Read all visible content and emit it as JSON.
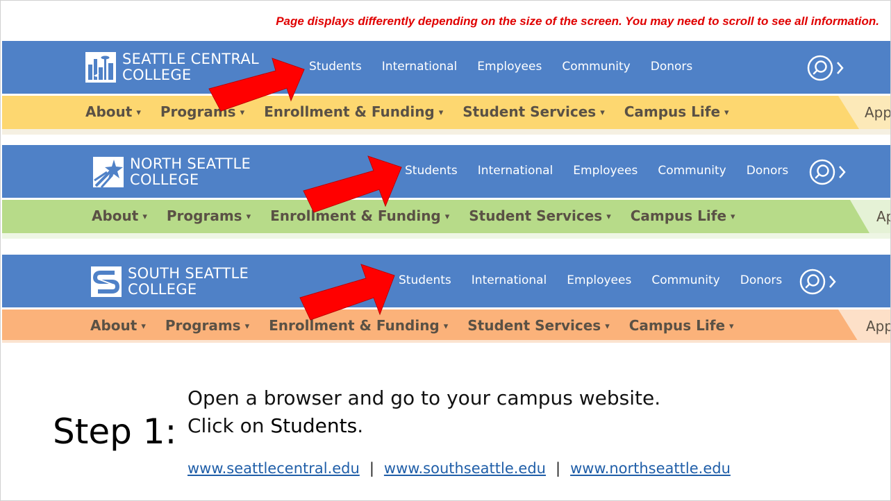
{
  "notice": "Page displays differently depending on the size of the screen. You may need to scroll to see all information.",
  "sites": [
    {
      "logo_line1": "SEATTLE CENTRAL",
      "logo_line2": "COLLEGE",
      "top_nav": [
        "Students",
        "International",
        "Employees",
        "Community",
        "Donors"
      ],
      "sub_nav": [
        "About",
        "Programs",
        "Enrollment & Funding",
        "Student Services",
        "Campus Life"
      ],
      "apply_label": "Appl",
      "colors": {
        "topbar": "#4f81c7",
        "subbar": "#fdd770",
        "apply": "#fce9b8"
      }
    },
    {
      "logo_line1": "NORTH SEATTLE",
      "logo_line2": "COLLEGE",
      "top_nav": [
        "Students",
        "International",
        "Employees",
        "Community",
        "Donors"
      ],
      "sub_nav": [
        "About",
        "Programs",
        "Enrollment & Funding",
        "Student Services",
        "Campus Life"
      ],
      "apply_label": "Ap",
      "colors": {
        "topbar": "#4f81c7",
        "subbar": "#b7db89",
        "apply": "#e5f2d6"
      }
    },
    {
      "logo_line1": "SOUTH SEATTLE",
      "logo_line2": "COLLEGE",
      "top_nav": [
        "Students",
        "International",
        "Employees",
        "Community",
        "Donors"
      ],
      "sub_nav": [
        "About",
        "Programs",
        "Enrollment & Funding",
        "Student Services",
        "Campus Life"
      ],
      "apply_label": "App",
      "colors": {
        "topbar": "#4f81c7",
        "subbar": "#fbb27a",
        "apply": "#fde0c8"
      }
    }
  ],
  "step": {
    "label": "Step 1:",
    "line1": "Open a browser and go to your campus website.",
    "line2_prefix": "Click on ",
    "line2_bold": "Students",
    "line2_suffix": "."
  },
  "links": [
    "www.seattlecentral.edu",
    "www.southseattle.edu",
    "www.northseattle.edu"
  ],
  "link_separator": "|",
  "icons": {
    "arrow": "red-arrow-icon",
    "search": "search-chevron-icon"
  },
  "colors": {
    "arrow": "#ff0000",
    "notice": "#e00000",
    "link": "#1f5ea8"
  }
}
